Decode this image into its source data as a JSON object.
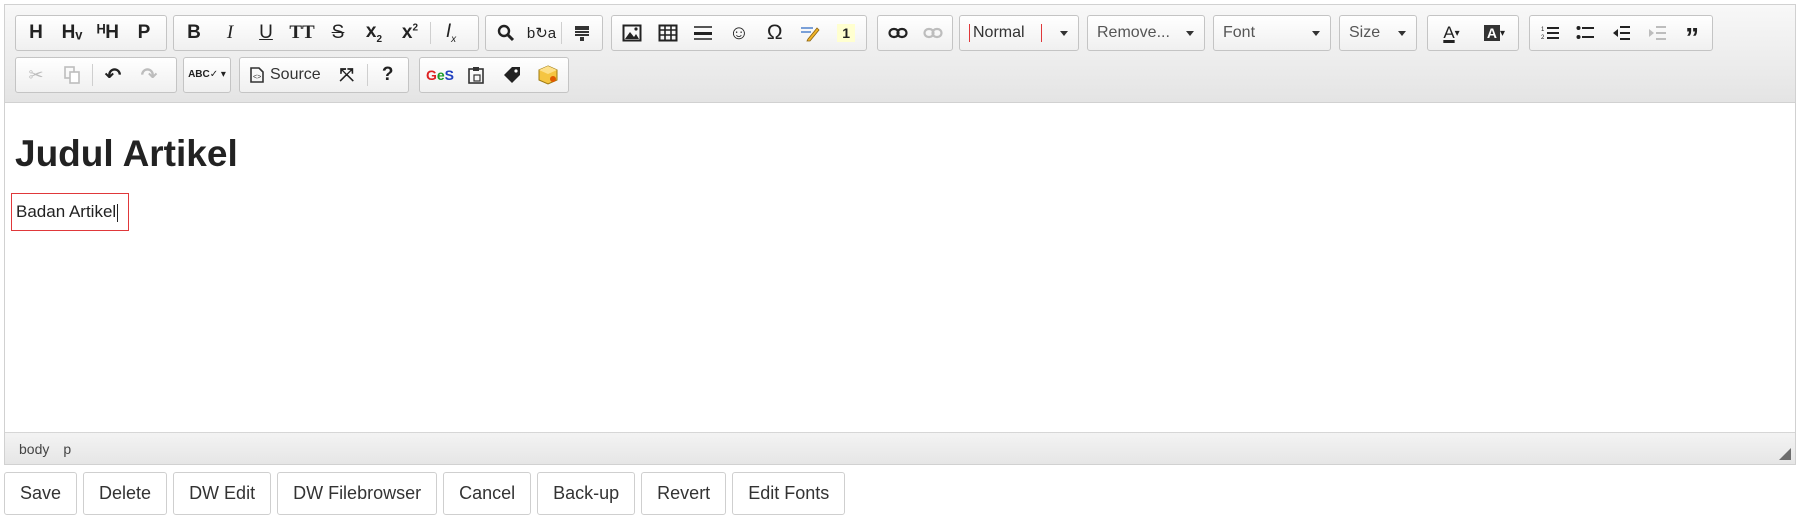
{
  "toolbar": {
    "headings": [
      "H",
      "Hᵥ",
      "ᴴH",
      "P"
    ],
    "style_combo": "Normal",
    "remove_combo": "Remove...",
    "font_combo": "Font",
    "size_combo": "Size",
    "source_label": "Source",
    "help_label": "?"
  },
  "document": {
    "heading": "Judul Artikel",
    "paragraph": "Badan Artikel"
  },
  "statusbar": {
    "path": [
      "body",
      "p"
    ]
  },
  "actions": {
    "save": "Save",
    "delete": "Delete",
    "dw_edit": "DW Edit",
    "dw_filebrowser": "DW Filebrowser",
    "cancel": "Cancel",
    "backup": "Back-up",
    "revert": "Revert",
    "edit_fonts": "Edit Fonts"
  },
  "colors": {
    "focus_border": "#e0383a",
    "toolbar_bg": "#e9e9e9"
  }
}
